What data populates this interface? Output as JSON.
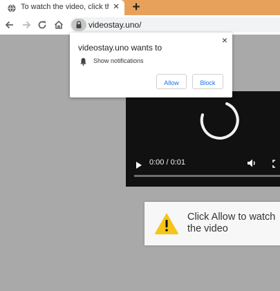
{
  "tab": {
    "title": "To watch the video, click the Allow",
    "close_glyph": "×",
    "new_tab_glyph": "+"
  },
  "toolbar": {
    "url": "videostay.uno/"
  },
  "popup": {
    "title": "videostay.uno wants to",
    "permission": "Show notifications",
    "allow_label": "Allow",
    "block_label": "Block",
    "close_glyph": "×"
  },
  "video": {
    "time": "0:00 / 0:01",
    "progress_fraction": 0
  },
  "cta": {
    "text": "Click Allow to watch the video"
  },
  "colors": {
    "tab_strip": "#e8a15a",
    "page_background": "#a9a9a9",
    "link_blue": "#1a73e8",
    "warning_yellow": "#f5c518"
  },
  "icons": [
    "globe-icon",
    "back-arrow-icon",
    "forward-arrow-icon",
    "reload-icon",
    "home-icon",
    "lock-icon",
    "bell-icon",
    "play-icon",
    "volume-icon",
    "fullscreen-icon",
    "warning-icon",
    "loading-spinner"
  ]
}
